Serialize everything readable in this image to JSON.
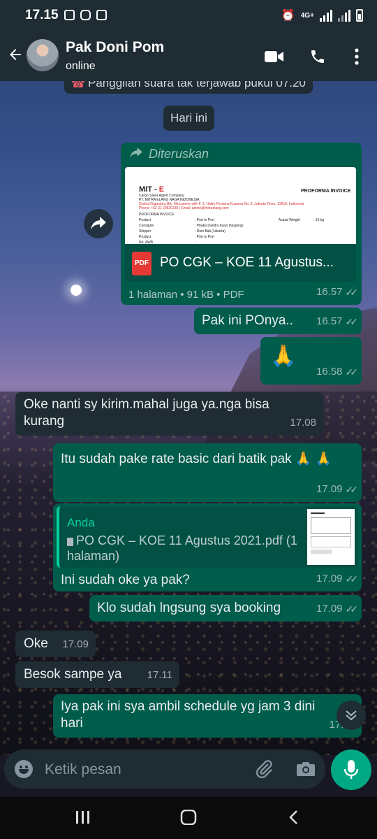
{
  "status_bar": {
    "time": "17.15",
    "network": "4G+"
  },
  "header": {
    "contact_name": "Pak Doni Pom",
    "contact_status": "online"
  },
  "chat": {
    "missed_call": "Panggilan suara tak terjawab pukul 07.20",
    "date_chip": "Hari ini",
    "forwarded": {
      "label": "Diteruskan",
      "doc_preview": {
        "brand_main": "MIT - ",
        "brand_accent": "E",
        "doc_title": "PROFORMA INVOICE",
        "company_line1": "Cargo Sales Agent Company",
        "company_line2": "PT. MITRA ELANG NAGA INDONESIA",
        "address": "Graha Dirgantara Blk. Mezzanine with F. 3, Halim Perdana Kusuma No. 8, Jakarta Timur, 13610, Indonesia",
        "contact": "Phone: +62 21 29820230 | Email: admin@mitraelang.com",
        "section": "PROFORMA INVOICE",
        "rows": [
          {
            "label": "Product",
            "value": ": Port to Port",
            "extra_label": "Actual Weight",
            "extra_value": ": 14 kg"
          },
          {
            "label": "Consigne",
            "value": ": Phaka Dandry Kaso (Nugong)",
            "extra_label": "",
            "extra_value": ""
          },
          {
            "label": "Shipper",
            "value": ": Doni Bali (Jakarta)",
            "extra_label": "",
            "extra_value": ""
          },
          {
            "label": "Product",
            "value": ": Port to Port",
            "extra_label": "",
            "extra_value": ""
          },
          {
            "label": "No. AWB",
            "value": ":",
            "extra_label": "",
            "extra_value": ""
          }
        ]
      },
      "file_icon_text": "PDF",
      "file_name": "PO CGK – KOE 11 Agustus...",
      "file_meta": "1 halaman • 91 kB • PDF",
      "time": "16.57"
    },
    "messages": [
      {
        "id": "m1",
        "text": "Pak ini POnya..",
        "time": "16.57"
      },
      {
        "id": "m2",
        "text": "🙏",
        "time": "16.58"
      },
      {
        "id": "m3",
        "text": "Oke nanti sy kirim.mahal juga ya.nga bisa kurang",
        "time": "17.08"
      },
      {
        "id": "m4",
        "text": "Itu sudah pake rate basic dari batik pak 🙏 🙏",
        "time": "17.09"
      },
      {
        "id": "m6",
        "text": "Klo sudah lngsung sya booking",
        "time": "17.09"
      },
      {
        "id": "m7",
        "text": "Oke",
        "time": "17.09"
      },
      {
        "id": "m8",
        "text": "Besok sampe ya",
        "time": "17.11"
      },
      {
        "id": "m9",
        "text": "Iya pak ini sya ambil schedule yg jam 3 dini hari",
        "time": "17.11"
      }
    ],
    "reply": {
      "quoted_author": "Anda",
      "quoted_text": "PO CGK – KOE 11 Agustus 2021.pdf (1 halaman)",
      "text": "Ini sudah oke ya pak?",
      "time": "17.09"
    }
  },
  "composer": {
    "placeholder": "Ketik pesan"
  },
  "colors": {
    "header_bg": "#1f2c34",
    "outgoing_bubble": "#005c4b",
    "incoming_bubble": "#1f2c34",
    "accent": "#00a884",
    "forward_label": "#8696a0",
    "link_green": "#06cf9c"
  }
}
